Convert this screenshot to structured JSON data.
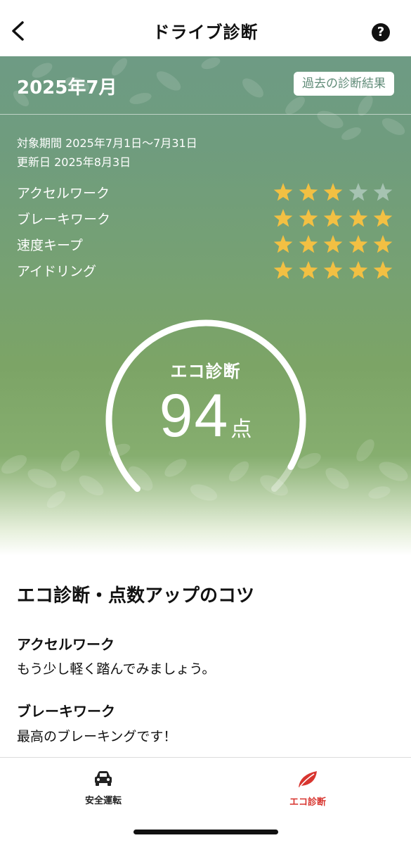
{
  "nav": {
    "title": "ドライブ診断",
    "help_icon": "?"
  },
  "hero": {
    "month": "2025年7月",
    "past_results_label": "過去の診断結果",
    "period": "対象期間 2025年7月1日〜7月31日",
    "updated": "更新日 2025年8月3日",
    "ratings": [
      {
        "label": "アクセルワーク",
        "stars": 3,
        "max": 5
      },
      {
        "label": "ブレーキワーク",
        "stars": 5,
        "max": 5
      },
      {
        "label": "速度キープ",
        "stars": 5,
        "max": 5
      },
      {
        "label": "アイドリング",
        "stars": 5,
        "max": 5
      }
    ],
    "gauge": {
      "title": "エコ診断",
      "score": "94",
      "unit": "点",
      "score_fraction": 0.94
    }
  },
  "tips": {
    "title": "エコ診断・点数アップのコツ",
    "items": [
      {
        "heading": "アクセルワーク",
        "text": "もう少し軽く踏んでみましょう。"
      },
      {
        "heading": "ブレーキワーク",
        "text": "最高のブレーキングです！"
      }
    ]
  },
  "tabbar": {
    "tabs": [
      {
        "label": "安全運転",
        "icon": "car-icon"
      },
      {
        "label": "エコ診断",
        "icon": "leaf-icon",
        "active": true
      }
    ]
  },
  "colors": {
    "accent_red": "#d8352f",
    "star_on": "#f2c043",
    "star_off": "#a6c3b2",
    "hero_top": "#6e9b84",
    "hero_bottom": "#86ae6f"
  }
}
